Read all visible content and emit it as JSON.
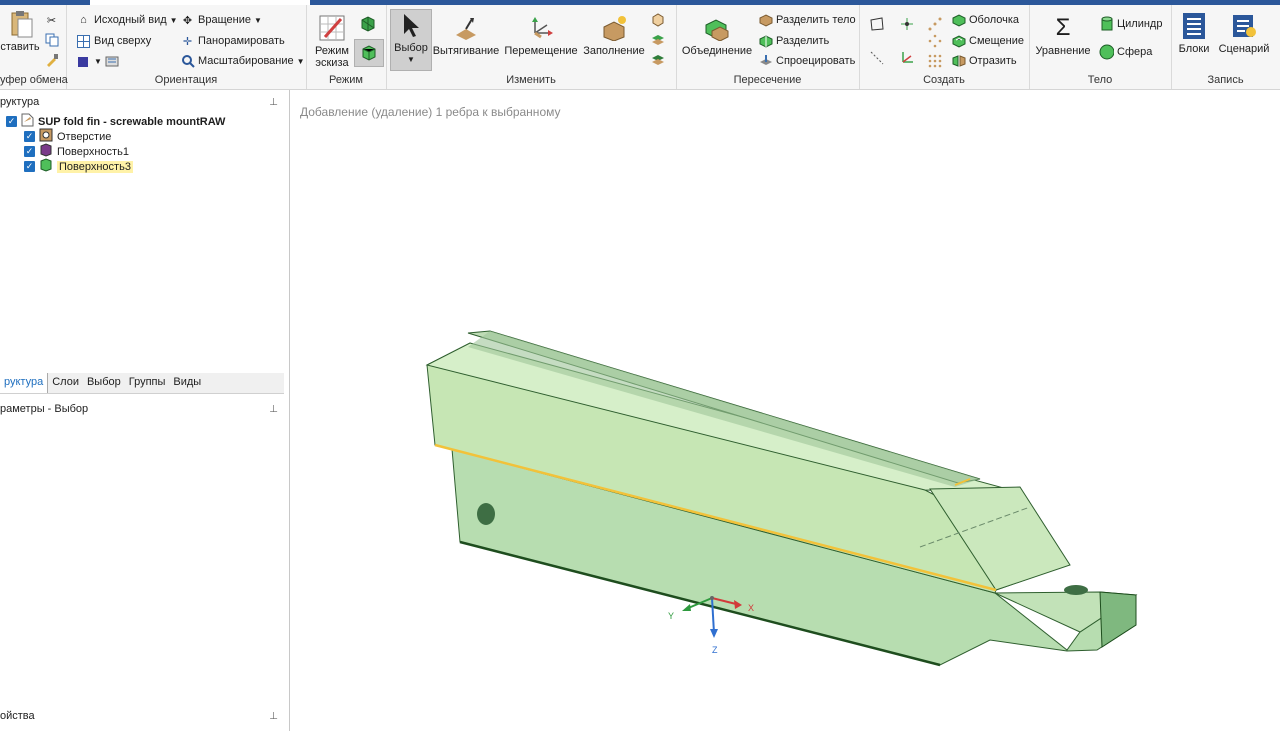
{
  "ribbon": {
    "clipboard": {
      "paste": "ставить",
      "label": "уфер обмена"
    },
    "orientation": {
      "home_view": "Исходный вид",
      "top_view": "Вид сверху",
      "rotate": "Вращение",
      "pan": "Панорамировать",
      "zoom": "Масштабирование",
      "label": "Ориентация"
    },
    "mode": {
      "sketch": "Режим эскиза",
      "label": "Режим"
    },
    "edit": {
      "select": "Выбор",
      "pull": "Вытягивание",
      "move": "Перемещение",
      "fill": "Заполнение",
      "label": "Изменить"
    },
    "intersect": {
      "combine": "Объединение",
      "split_body": "Разделить тело",
      "split": "Разделить",
      "project": "Спроецировать",
      "label": "Пересечение"
    },
    "create": {
      "shell": "Оболочка",
      "offset": "Смещение",
      "mirror": "Отразить",
      "label": "Создать"
    },
    "body": {
      "equation": "Уравнение",
      "cylinder": "Цилиндр",
      "sphere": "Сфера",
      "label": "Тело"
    },
    "record": {
      "blocks": "Блоки",
      "script": "Сценарий",
      "label": "Запись"
    }
  },
  "panels": {
    "structure_title": "руктура",
    "tree": [
      {
        "label": "SUP fold fin - screwable mountRAW"
      },
      {
        "label": "Отверстие"
      },
      {
        "label": "Поверхность1"
      },
      {
        "label": "Поверхность3"
      }
    ],
    "tabs": [
      "руктура",
      "Слои",
      "Выбор",
      "Группы",
      "Виды"
    ],
    "params_title": "раметры - Выбор",
    "props_title": "ойства"
  },
  "viewport": {
    "hint": "Добавление (удаление) 1 ребра к выбранному",
    "axes": {
      "x": "X",
      "y": "Y",
      "z": "Z"
    }
  },
  "colors": {
    "accent": "#2b579a",
    "body": "#c6e6b4",
    "highlight": "#f2c23a"
  }
}
